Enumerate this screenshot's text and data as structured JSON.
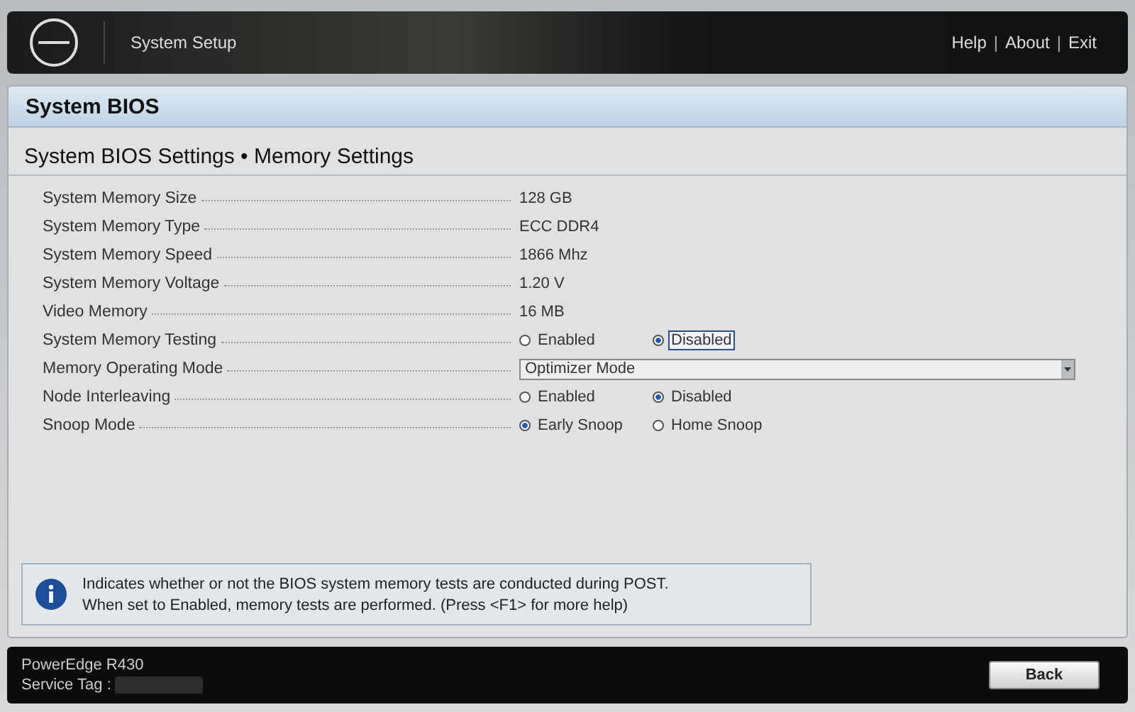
{
  "header": {
    "title": "System Setup",
    "links": [
      "Help",
      "About",
      "Exit"
    ],
    "separator": "|"
  },
  "page": {
    "title": "System BIOS",
    "subtitle": "System BIOS Settings • Memory Settings"
  },
  "settings": [
    {
      "kind": "text",
      "label": "System Memory Size",
      "value": "128 GB"
    },
    {
      "kind": "text",
      "label": "System Memory Type",
      "value": "ECC DDR4"
    },
    {
      "kind": "text",
      "label": "System Memory Speed",
      "value": "1866 Mhz"
    },
    {
      "kind": "text",
      "label": "System Memory Voltage",
      "value": "1.20 V"
    },
    {
      "kind": "text",
      "label": "Video Memory",
      "value": "16 MB"
    },
    {
      "kind": "radio",
      "label": "System Memory Testing",
      "options": [
        {
          "label": "Enabled",
          "selected": false,
          "focused": false
        },
        {
          "label": "Disabled",
          "selected": true,
          "focused": true
        }
      ]
    },
    {
      "kind": "dropdown",
      "label": "Memory Operating Mode",
      "value": "Optimizer Mode"
    },
    {
      "kind": "radio",
      "label": "Node Interleaving",
      "options": [
        {
          "label": "Enabled",
          "selected": false,
          "focused": false
        },
        {
          "label": "Disabled",
          "selected": true,
          "focused": false
        }
      ]
    },
    {
      "kind": "radio",
      "label": "Snoop Mode",
      "options": [
        {
          "label": "Early Snoop",
          "selected": true,
          "focused": false
        },
        {
          "label": "Home Snoop",
          "selected": false,
          "focused": false
        }
      ]
    }
  ],
  "help": [
    "Indicates whether or not the BIOS system memory tests are conducted during POST.",
    "When set to Enabled, memory tests are performed. (Press <F1> for more help)"
  ],
  "footer": {
    "model": "PowerEdge R430",
    "service_tag_label": "Service Tag :",
    "button": "Back"
  }
}
